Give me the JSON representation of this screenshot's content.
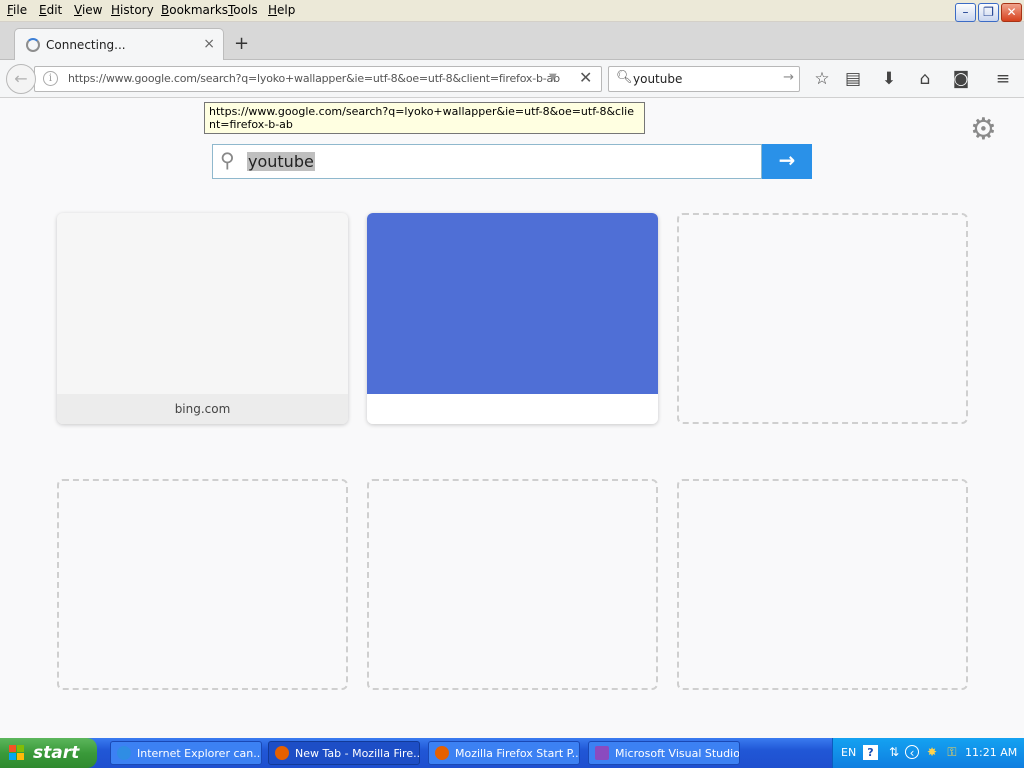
{
  "menubar": {
    "items": [
      "File",
      "Edit",
      "View",
      "History",
      "Bookmarks",
      "Tools",
      "Help"
    ]
  },
  "window_controls": {
    "minimize": "–",
    "restore": "❐",
    "close": "✕"
  },
  "tab": {
    "title": "Connecting...",
    "close": "×",
    "new_tab": "+"
  },
  "navbar": {
    "url": "https://www.google.com/search?q=lyoko+wallapper&ie=utf-8&oe=utf-8&client=firefox-b-ab",
    "search_value": "youtube"
  },
  "tooltip": {
    "text": "https://www.google.com/search?q=lyoko+wallapper&ie=utf-8&oe=utf-8&client=firefox-b-ab"
  },
  "newtab": {
    "search_value": "youtube",
    "go": "→",
    "tiles": [
      {
        "label": "bing.com",
        "kind": "filled"
      },
      {
        "label": "",
        "kind": "blue"
      },
      {
        "kind": "empty"
      },
      {
        "kind": "empty"
      },
      {
        "kind": "empty"
      },
      {
        "kind": "empty"
      }
    ]
  },
  "taskbar": {
    "start": "start",
    "tasks": [
      {
        "label": "Internet Explorer can...",
        "icon": "ie-icon",
        "active": false
      },
      {
        "label": "New Tab - Mozilla Fire...",
        "icon": "firefox-icon",
        "active": true
      },
      {
        "label": "Mozilla Firefox Start P...",
        "icon": "firefox-icon",
        "active": false
      },
      {
        "label": "Microsoft Visual Studio",
        "icon": "visual-studio-icon",
        "active": false
      }
    ],
    "tray": {
      "lang": "EN",
      "help": "?",
      "clock": "11:21 AM"
    }
  },
  "colors": {
    "accent_blue": "#2a91e8",
    "tile_blue": "#4f6fd6",
    "taskbar": "#2157d6",
    "start_green": "#3a9a3a"
  }
}
